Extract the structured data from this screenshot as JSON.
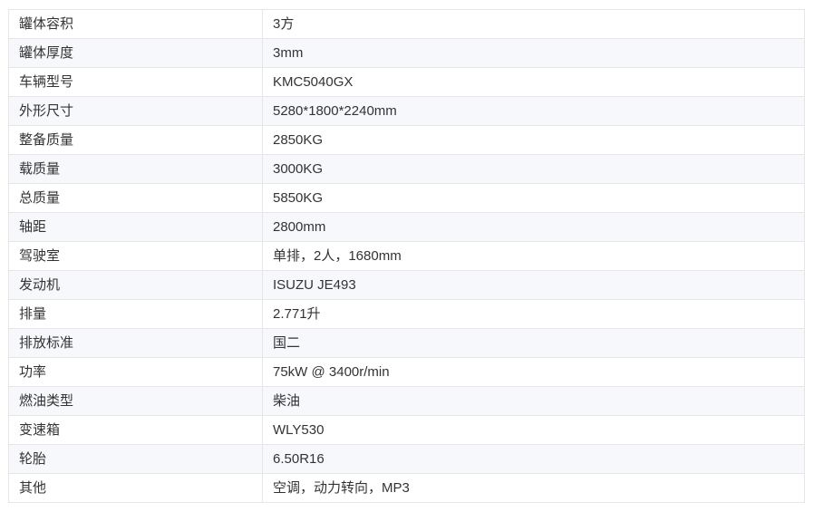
{
  "spec_table": {
    "rows": [
      {
        "key": "罐体容积",
        "value": "3方"
      },
      {
        "key": "罐体厚度",
        "value": "3mm"
      },
      {
        "key": "车辆型号",
        "value": "KMC5040GX"
      },
      {
        "key": "外形尺寸",
        "value": "5280*1800*2240mm"
      },
      {
        "key": "整备质量",
        "value": "2850KG"
      },
      {
        "key": "载质量",
        "value": "3000KG"
      },
      {
        "key": "总质量",
        "value": "5850KG"
      },
      {
        "key": "轴距",
        "value": "2800mm"
      },
      {
        "key": "驾驶室",
        "value": "单排，2人，1680mm"
      },
      {
        "key": "发动机",
        "value": "ISUZU JE493"
      },
      {
        "key": "排量",
        "value": "2.771升"
      },
      {
        "key": "排放标准",
        "value": "国二"
      },
      {
        "key": "功率",
        "value": "75kW @ 3400r/min"
      },
      {
        "key": "燃油类型",
        "value": "柴油"
      },
      {
        "key": "变速箱",
        "value": "WLY530"
      },
      {
        "key": "轮胎",
        "value": "6.50R16"
      },
      {
        "key": "其他",
        "value": "空调，动力转向，MP3"
      }
    ]
  }
}
